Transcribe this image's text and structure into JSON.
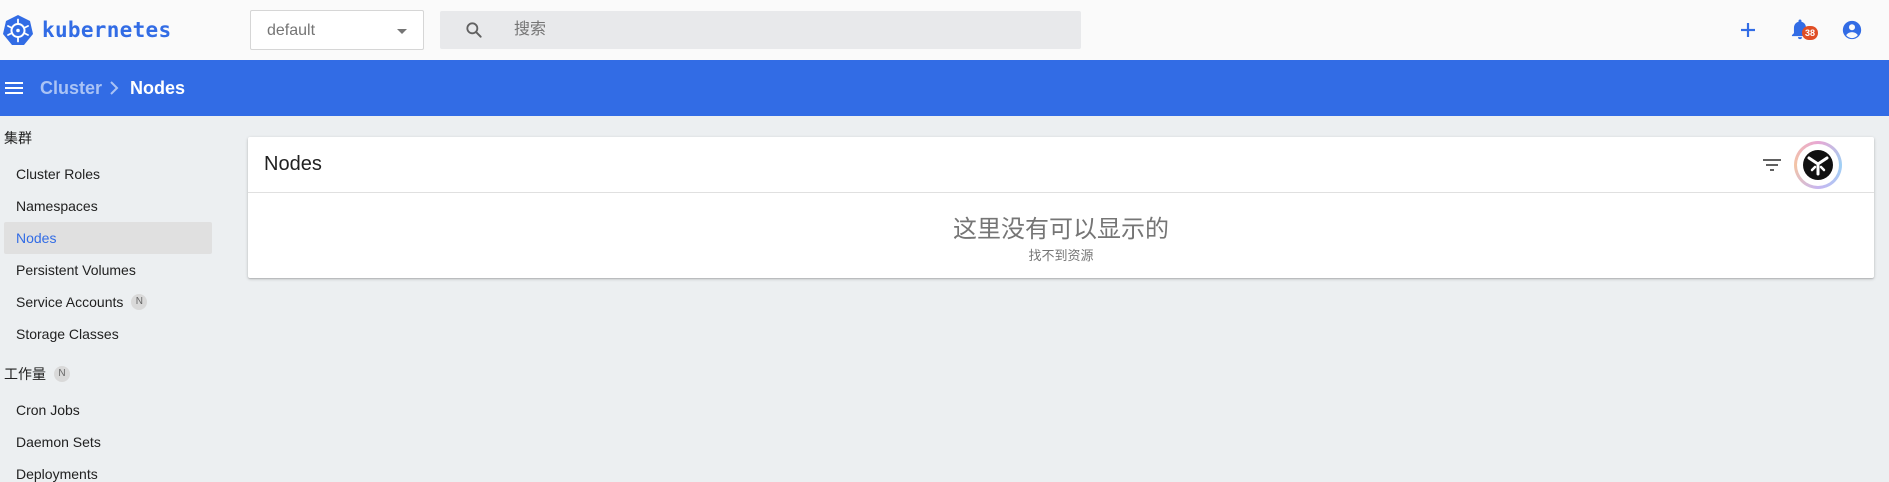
{
  "header": {
    "brand": "kubernetes",
    "namespace": {
      "value": "default"
    },
    "search": {
      "placeholder": "搜索"
    },
    "notifications": {
      "count": "38"
    },
    "icons": {
      "logo": "kubernetes-helm-icon",
      "add": "plus-icon",
      "notifications": "bell-icon",
      "account": "account-circle-icon"
    }
  },
  "breadcrumb": {
    "parent": "Cluster",
    "current": "Nodes"
  },
  "sidebar": {
    "sections": [
      {
        "label": "集群",
        "badge": ""
      },
      {
        "label": "工作量",
        "badge": "N"
      }
    ],
    "cluster_items": [
      {
        "label": "Cluster Roles",
        "badge": ""
      },
      {
        "label": "Namespaces",
        "badge": ""
      },
      {
        "label": "Nodes",
        "badge": "",
        "active": true
      },
      {
        "label": "Persistent Volumes",
        "badge": ""
      },
      {
        "label": "Service Accounts",
        "badge": "N"
      },
      {
        "label": "Storage Classes",
        "badge": ""
      }
    ],
    "workload_items": [
      {
        "label": "Cron Jobs"
      },
      {
        "label": "Daemon Sets"
      },
      {
        "label": "Deployments"
      }
    ]
  },
  "main": {
    "card_title": "Nodes",
    "empty_title": "这里没有可以显示的",
    "empty_subtitle": "找不到资源"
  },
  "colors": {
    "brand": "#326ce5",
    "background": "#eceff1",
    "badge": "#e04e25"
  }
}
